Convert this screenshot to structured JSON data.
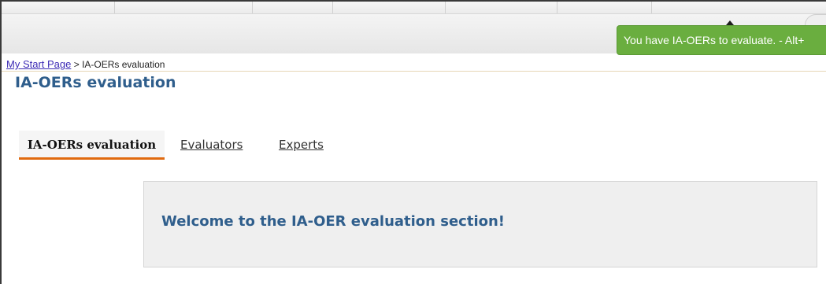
{
  "notification": {
    "text": "You have IA-OERs to evaluate. - Alt+"
  },
  "breadcrumb": {
    "home_link": "My Start Page",
    "separator": " > ",
    "current": "IA-OERs evaluation"
  },
  "page": {
    "title": "IA-OERs evaluation"
  },
  "tabs": [
    {
      "label": "IA-OERs evaluation",
      "active": true
    },
    {
      "label": "Evaluators",
      "active": false
    },
    {
      "label": "Experts",
      "active": false
    }
  ],
  "welcome": {
    "message": "Welcome to the IA-OER evaluation section!"
  },
  "colors": {
    "notification_bg": "#6aae3f",
    "title_blue": "#2f5e8c",
    "tab_active_underline": "#e06a0f",
    "link": "#3c2bb5"
  }
}
